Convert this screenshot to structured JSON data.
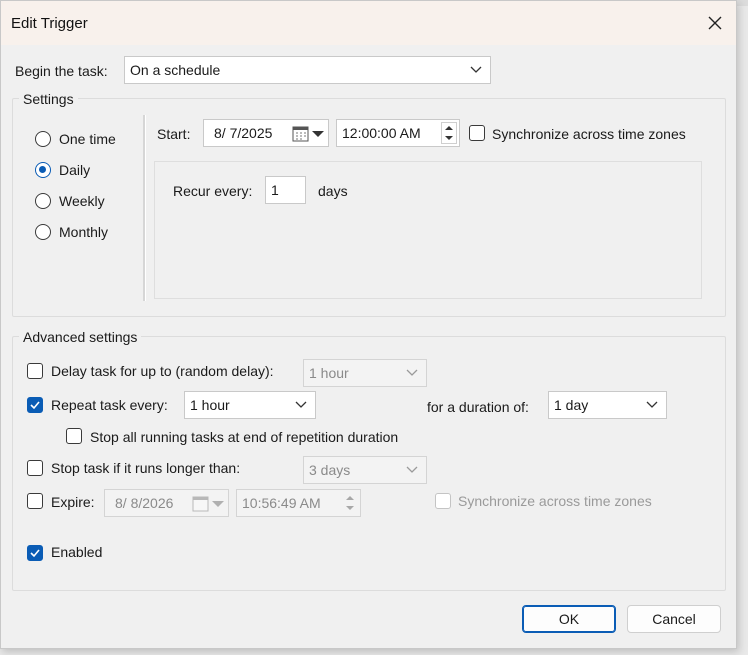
{
  "dialog": {
    "title": "Edit Trigger",
    "close_icon": "close-icon"
  },
  "begin": {
    "label": "Begin the task:",
    "value": "On a schedule"
  },
  "settings": {
    "group_label": "Settings",
    "radios": [
      {
        "label": "One time",
        "selected": false
      },
      {
        "label": "Daily",
        "selected": true
      },
      {
        "label": "Weekly",
        "selected": false
      },
      {
        "label": "Monthly",
        "selected": false
      }
    ],
    "start_label": "Start:",
    "start_date": "8/  7/2025",
    "start_time": "12:00:00 AM",
    "sync_label": "Synchronize across time zones",
    "sync_checked": false,
    "recur_label": "Recur every:",
    "recur_value": "1",
    "recur_unit": "days"
  },
  "advanced": {
    "group_label": "Advanced settings",
    "delay_label": "Delay task for up to (random delay):",
    "delay_checked": false,
    "delay_value": "1 hour",
    "repeat_label": "Repeat task every:",
    "repeat_checked": true,
    "repeat_value": "1 hour",
    "duration_label": "for a duration of:",
    "duration_value": "1 day",
    "stop_all_label": "Stop all running tasks at end of repetition duration",
    "stop_all_checked": false,
    "stop_longer_label": "Stop task if it runs longer than:",
    "stop_longer_checked": false,
    "stop_longer_value": "3 days",
    "expire_label": "Expire:",
    "expire_checked": false,
    "expire_date": "8/  8/2026",
    "expire_time": "10:56:49 AM",
    "expire_sync_label": "Synchronize across time zones",
    "enabled_label": "Enabled",
    "enabled_checked": true
  },
  "buttons": {
    "ok": "OK",
    "cancel": "Cancel"
  },
  "colors": {
    "accent": "#0a5cb5",
    "titlebar": "#f8f1ec",
    "dialog_bg": "#f0f0f0"
  }
}
